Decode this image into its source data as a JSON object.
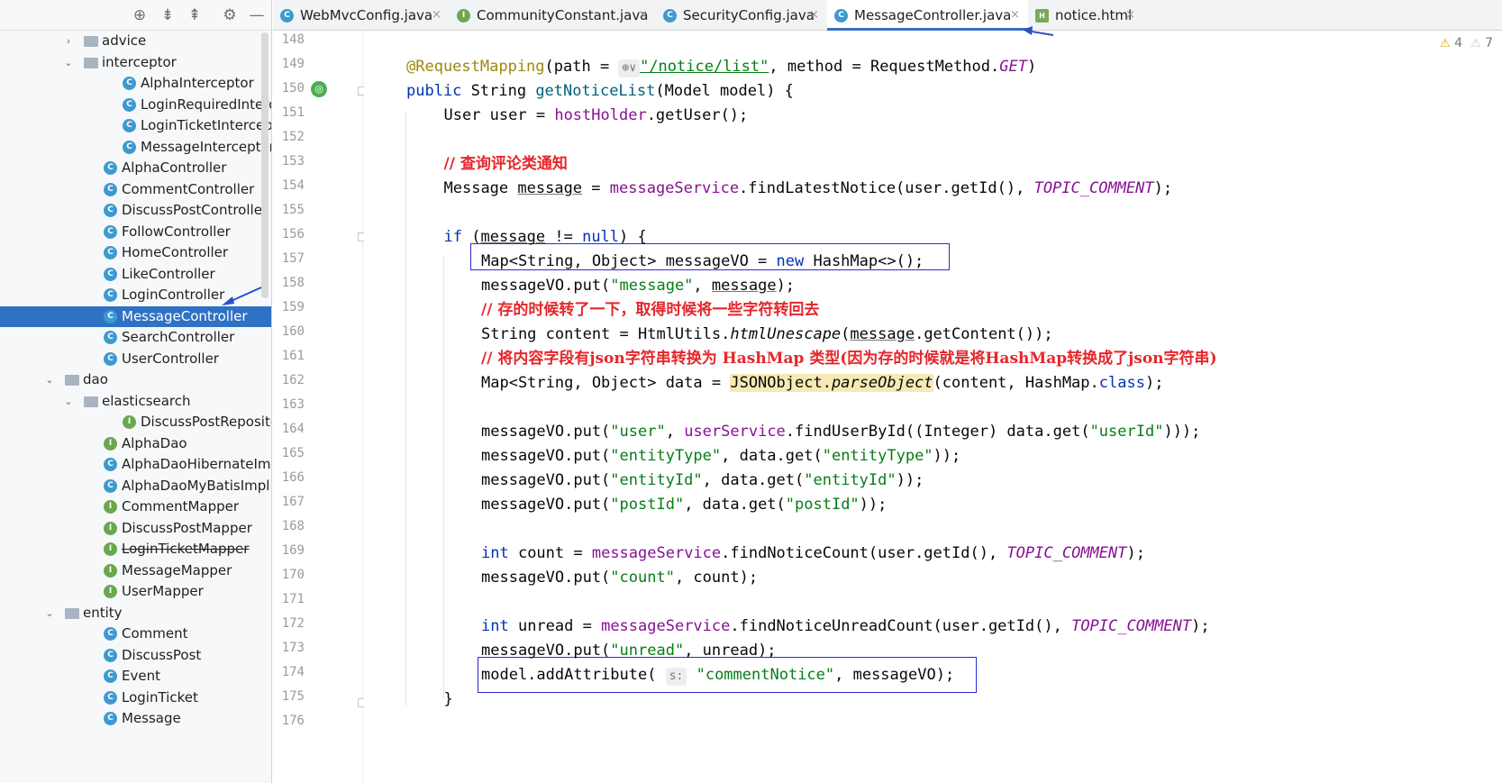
{
  "toolbar": {
    "icons": [
      "target-icon",
      "expand-all-icon",
      "collapse-all-icon",
      "gear-icon",
      "minimize-icon"
    ]
  },
  "tree": [
    {
      "label": "advice",
      "type": "folder",
      "depth": 1,
      "expanded": false
    },
    {
      "label": "interceptor",
      "type": "folder",
      "depth": 1,
      "expanded": true
    },
    {
      "label": "AlphaInterceptor",
      "type": "class",
      "depth": 2
    },
    {
      "label": "LoginRequiredIntercept",
      "type": "class",
      "depth": 2
    },
    {
      "label": "LoginTicketInterceptor",
      "type": "class",
      "depth": 2
    },
    {
      "label": "MessageInterceptor",
      "type": "class",
      "depth": 2
    },
    {
      "label": "AlphaController",
      "type": "class",
      "depth": 1
    },
    {
      "label": "CommentController",
      "type": "class",
      "depth": 1
    },
    {
      "label": "DiscussPostController",
      "type": "class",
      "depth": 1
    },
    {
      "label": "FollowController",
      "type": "class",
      "depth": 1
    },
    {
      "label": "HomeController",
      "type": "class",
      "depth": 1
    },
    {
      "label": "LikeController",
      "type": "class",
      "depth": 1
    },
    {
      "label": "LoginController",
      "type": "class",
      "depth": 1
    },
    {
      "label": "MessageController",
      "type": "class",
      "depth": 1,
      "selected": true
    },
    {
      "label": "SearchController",
      "type": "class",
      "depth": 1
    },
    {
      "label": "UserController",
      "type": "class",
      "depth": 1
    },
    {
      "label": "dao",
      "type": "folder",
      "depth": 0,
      "expanded": true
    },
    {
      "label": "elasticsearch",
      "type": "folder",
      "depth": 1,
      "expanded": true
    },
    {
      "label": "DiscussPostRepository",
      "type": "interface",
      "depth": 2
    },
    {
      "label": "AlphaDao",
      "type": "interface",
      "depth": 1
    },
    {
      "label": "AlphaDaoHibernateImpl",
      "type": "class",
      "depth": 1
    },
    {
      "label": "AlphaDaoMyBatisImpl",
      "type": "class",
      "depth": 1
    },
    {
      "label": "CommentMapper",
      "type": "interface",
      "depth": 1
    },
    {
      "label": "DiscussPostMapper",
      "type": "interface",
      "depth": 1
    },
    {
      "label": "LoginTicketMapper",
      "type": "interface",
      "depth": 1,
      "strike": true
    },
    {
      "label": "MessageMapper",
      "type": "interface",
      "depth": 1
    },
    {
      "label": "UserMapper",
      "type": "interface",
      "depth": 1
    },
    {
      "label": "entity",
      "type": "folder",
      "depth": 0,
      "expanded": true
    },
    {
      "label": "Comment",
      "type": "class",
      "depth": 1
    },
    {
      "label": "DiscussPost",
      "type": "class",
      "depth": 1
    },
    {
      "label": "Event",
      "type": "class",
      "depth": 1
    },
    {
      "label": "LoginTicket",
      "type": "class",
      "depth": 1
    },
    {
      "label": "Message",
      "type": "class",
      "depth": 1
    }
  ],
  "tabs": [
    {
      "label": "WebMvcConfig.java",
      "icon": "C",
      "kind": "class"
    },
    {
      "label": "CommunityConstant.java",
      "icon": "I",
      "kind": "interface"
    },
    {
      "label": "SecurityConfig.java",
      "icon": "C",
      "kind": "class"
    },
    {
      "label": "MessageController.java",
      "icon": "C",
      "kind": "class",
      "active": true
    },
    {
      "label": "notice.html",
      "icon": "H",
      "kind": "html"
    }
  ],
  "tab_close": "×",
  "warnings": {
    "weak_count": "4",
    "strong_count": "7",
    "icon": "⚠"
  },
  "gutter": {
    "marker_icon": "run-bean-icon"
  },
  "line_numbers": [
    "148",
    "149",
    "150",
    "151",
    "152",
    "153",
    "154",
    "155",
    "156",
    "157",
    "158",
    "159",
    "160",
    "161",
    "162",
    "163",
    "164",
    "165",
    "166",
    "167",
    "168",
    "169",
    "170",
    "171",
    "172",
    "173",
    "174",
    "175",
    "176"
  ],
  "code": [
    {
      "indent": 0,
      "tokens": []
    },
    {
      "indent": 1,
      "tokens": [
        [
          "ann",
          "@RequestMapping"
        ],
        [
          "",
          "(path = "
        ],
        [
          "hint",
          "⊕∨"
        ],
        [
          "url",
          "\"/notice/list\""
        ],
        [
          "",
          ", method = RequestMethod."
        ],
        [
          "cst",
          "GET"
        ],
        [
          "",
          ")"
        ]
      ]
    },
    {
      "indent": 1,
      "tokens": [
        [
          "kw",
          "public "
        ],
        [
          "",
          "String "
        ],
        [
          "fn",
          "getNoticeList"
        ],
        [
          "",
          "(Model model) {"
        ]
      ]
    },
    {
      "indent": 2,
      "tokens": [
        [
          "",
          "User user = "
        ],
        [
          "fld",
          "hostHolder"
        ],
        [
          "",
          ".getUser();"
        ]
      ]
    },
    {
      "indent": 0,
      "tokens": []
    },
    {
      "indent": 2,
      "tokens": [
        [
          "cm",
          "// 查询评论类通知"
        ]
      ]
    },
    {
      "indent": 2,
      "tokens": [
        [
          "",
          "Message "
        ],
        [
          "und",
          "message"
        ],
        [
          "",
          " = "
        ],
        [
          "fld",
          "messageService"
        ],
        [
          "",
          ".findLatestNotice(user.getId(), "
        ],
        [
          "cst",
          "TOPIC_COMMENT"
        ],
        [
          "",
          ");"
        ]
      ]
    },
    {
      "indent": 0,
      "tokens": []
    },
    {
      "indent": 2,
      "tokens": [
        [
          "kw",
          "if "
        ],
        [
          "",
          "("
        ],
        [
          "und",
          "message"
        ],
        [
          "",
          " != "
        ],
        [
          "kw",
          "null"
        ],
        [
          "",
          ") {"
        ]
      ]
    },
    {
      "indent": 3,
      "tokens": [
        [
          "",
          "Map<String, Object> messageVO = "
        ],
        [
          "kw",
          "new "
        ],
        [
          "",
          "HashMap<>();"
        ]
      ]
    },
    {
      "indent": 3,
      "tokens": [
        [
          "",
          "messageVO.put("
        ],
        [
          "str",
          "\"message\""
        ],
        [
          "",
          ", "
        ],
        [
          "und",
          "message"
        ],
        [
          "",
          ");"
        ]
      ]
    },
    {
      "indent": 3,
      "tokens": [
        [
          "cm",
          "// 存的时候转了一下，取得时候将一些字符转回去"
        ]
      ]
    },
    {
      "indent": 3,
      "tokens": [
        [
          "",
          "String content = HtmlUtils."
        ],
        [
          "itl",
          "htmlUnescape"
        ],
        [
          "",
          "("
        ],
        [
          "und",
          "message"
        ],
        [
          "",
          ".getContent());"
        ]
      ]
    },
    {
      "indent": 3,
      "tokens": [
        [
          "cm",
          "// 将内容字段有json字符串转换为 HashMap 类型(因为存的时候就是将HashMap转换成了json字符串)"
        ]
      ]
    },
    {
      "indent": 3,
      "tokens": [
        [
          "",
          "Map<String, Object> data = "
        ],
        [
          "hl",
          "JSONObject."
        ],
        [
          "hli",
          "parseObject"
        ],
        [
          "",
          "(content, HashMap."
        ],
        [
          "kw",
          "class"
        ],
        [
          "",
          ");"
        ]
      ]
    },
    {
      "indent": 0,
      "tokens": []
    },
    {
      "indent": 3,
      "tokens": [
        [
          "",
          "messageVO.put("
        ],
        [
          "str",
          "\"user\""
        ],
        [
          "",
          ", "
        ],
        [
          "fld",
          "userService"
        ],
        [
          "",
          ".findUserById((Integer) data.get("
        ],
        [
          "str",
          "\"userId\""
        ],
        [
          "",
          ")));"
        ]
      ]
    },
    {
      "indent": 3,
      "tokens": [
        [
          "",
          "messageVO.put("
        ],
        [
          "str",
          "\"entityType\""
        ],
        [
          "",
          ", data.get("
        ],
        [
          "str",
          "\"entityType\""
        ],
        [
          "",
          "));"
        ]
      ]
    },
    {
      "indent": 3,
      "tokens": [
        [
          "",
          "messageVO.put("
        ],
        [
          "str",
          "\"entityId\""
        ],
        [
          "",
          ", data.get("
        ],
        [
          "str",
          "\"entityId\""
        ],
        [
          "",
          "));"
        ]
      ]
    },
    {
      "indent": 3,
      "tokens": [
        [
          "",
          "messageVO.put("
        ],
        [
          "str",
          "\"postId\""
        ],
        [
          "",
          ", data.get("
        ],
        [
          "str",
          "\"postId\""
        ],
        [
          "",
          "));"
        ]
      ]
    },
    {
      "indent": 0,
      "tokens": []
    },
    {
      "indent": 3,
      "tokens": [
        [
          "kw",
          "int "
        ],
        [
          "",
          "count = "
        ],
        [
          "fld",
          "messageService"
        ],
        [
          "",
          ".findNoticeCount(user.getId(), "
        ],
        [
          "cst",
          "TOPIC_COMMENT"
        ],
        [
          "",
          ");"
        ]
      ]
    },
    {
      "indent": 3,
      "tokens": [
        [
          "",
          "messageVO.put("
        ],
        [
          "str",
          "\"count\""
        ],
        [
          "",
          ", count);"
        ]
      ]
    },
    {
      "indent": 0,
      "tokens": []
    },
    {
      "indent": 3,
      "tokens": [
        [
          "kw",
          "int "
        ],
        [
          "",
          "unread = "
        ],
        [
          "fld",
          "messageService"
        ],
        [
          "",
          ".findNoticeUnreadCount(user.getId(), "
        ],
        [
          "cst",
          "TOPIC_COMMENT"
        ],
        [
          "",
          ");"
        ]
      ]
    },
    {
      "indent": 3,
      "tokens": [
        [
          "",
          "messageVO.put("
        ],
        [
          "str",
          "\"unread\""
        ],
        [
          "",
          ", unread);"
        ]
      ]
    },
    {
      "indent": 3,
      "tokens": [
        [
          "",
          "model.addAttribute( "
        ],
        [
          "hint",
          "s:"
        ],
        [
          "str",
          " \"commentNotice\""
        ],
        [
          "",
          ", messageVO);"
        ]
      ]
    },
    {
      "indent": 2,
      "tokens": [
        [
          "",
          "}"
        ]
      ]
    },
    {
      "indent": 0,
      "tokens": []
    }
  ],
  "colors": {
    "selection": "#2f72c4",
    "keyword": "#0033b3",
    "string": "#067d17",
    "annotation": "#9e880d",
    "field": "#871094",
    "comment": "#e5262b",
    "box": "#2b2bd1"
  }
}
